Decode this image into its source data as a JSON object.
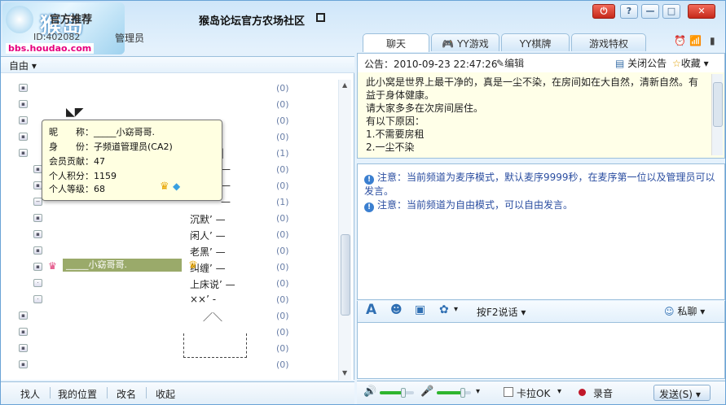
{
  "window": {
    "logo_text": "猴岛",
    "logo_url": "bbs.houdao.com",
    "tag": "官方推荐",
    "title": "猴岛论坛官方农场社区",
    "id_label": "ID:402082",
    "role": "管理员",
    "power_icon": "power-icon",
    "help": "?",
    "min": "—",
    "max": "□",
    "close": "✕"
  },
  "tabs": [
    {
      "label": "聊天",
      "active": true
    },
    {
      "label": "YY游戏"
    },
    {
      "label": "YY棋牌"
    },
    {
      "label": "游戏特权"
    }
  ],
  "left": {
    "mode": "自由",
    "rooms": [
      {
        "name": "",
        "count": "(0)"
      },
      {
        "name": "",
        "count": "(0)"
      },
      {
        "name": "",
        "count": "(0)"
      },
      {
        "name": "",
        "count": "(0)"
      },
      {
        "name": "|",
        "count": "(1)"
      },
      {
        "name": "—",
        "count": "(0)"
      },
      {
        "name": "—",
        "count": "(0)"
      },
      {
        "name": "—",
        "count": "(1)"
      },
      {
        "name": "沉默’ —",
        "count": "(0)"
      },
      {
        "name": "闲人’ —",
        "count": "(0)"
      },
      {
        "name": "老黑’ —",
        "count": "(0)"
      },
      {
        "name": "纠缠’ —",
        "count": "(0)"
      },
      {
        "name": "上床说’ —",
        "count": "(0)"
      },
      {
        "name": "××’ -",
        "count": "(0)"
      },
      {
        "name": "／＼",
        "count": "(0)"
      },
      {
        "name": "",
        "count": "(0)"
      },
      {
        "name": "",
        "count": "(0)"
      },
      {
        "name": "",
        "count": "(0)"
      }
    ],
    "selected_user": "_____小窈哥哥.",
    "bottom": [
      "找人",
      "我的位置",
      "改名",
      "收起"
    ]
  },
  "tooltip": {
    "nick": "昵　　称：_____小窈哥哥.",
    "identity": "身　　份：子频道管理员(CA2)",
    "contribution": "会员贡献：47",
    "points": "个人积分：1159",
    "level": "个人等级：68"
  },
  "notice": {
    "label": "公告：2010-09-23 22:47:26",
    "edit": "编辑",
    "close": "关闭公告",
    "collect": "收藏",
    "lines": [
      "此小窝是世界上最干净的，真是一尘不染，在房间如在大自然，清新自然。有",
      "益于身体健康。",
      "请大家多多在次房间居住。",
      "有以下原因：",
      "1.不需要房租",
      "2.一尘不染"
    ]
  },
  "messages": [
    "注意：当前频道为麦序模式，默认麦序9999秒，在麦序第一位以及管理员可以发言。",
    "注意：当前频道为自由模式，可以自由发言。"
  ],
  "toolbar": {
    "push_to_talk": "按F2说话",
    "private_chat": "私聊"
  },
  "bottom": {
    "karaoke": "卡拉OK",
    "record": "录音",
    "send": "发送(S)",
    "speaker_volume": 0.7,
    "mic_volume": 0.75
  }
}
